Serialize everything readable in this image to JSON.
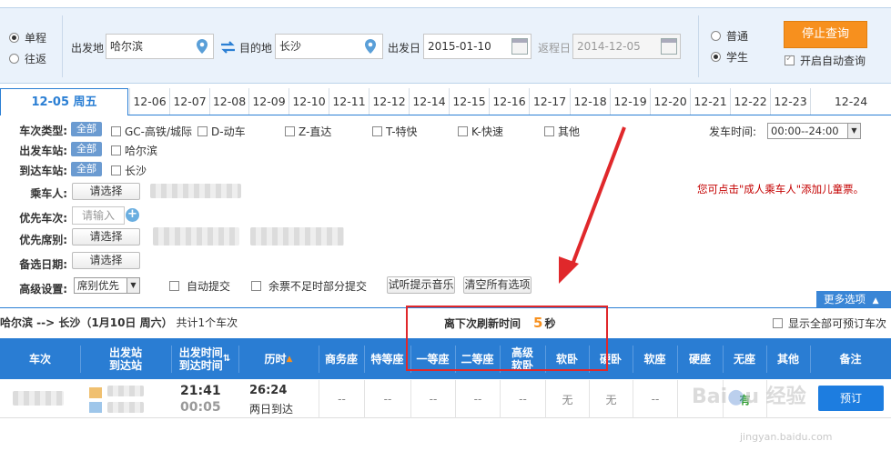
{
  "search": {
    "trip_type": {
      "one_way": "单程",
      "round_trip": "往返",
      "selected": "one_way"
    },
    "from_label": "出发地",
    "from_value": "哈尔滨",
    "to_label": "目的地",
    "to_value": "长沙",
    "depart_label": "出发日",
    "depart_value": "2015-01-10",
    "return_label": "返程日",
    "return_value": "2014-12-05",
    "ticket_type": {
      "normal": "普通",
      "student": "学生",
      "selected": "student"
    },
    "stop_button": "停止查询",
    "auto_query": "开启自动查询"
  },
  "dates": {
    "active": "12-05 周五",
    "tabs": [
      "12-06",
      "12-07",
      "12-08",
      "12-09",
      "12-10",
      "12-11",
      "12-12",
      "12-14",
      "12-15",
      "12-16",
      "12-17",
      "12-18",
      "12-19",
      "12-20",
      "12-21",
      "12-22",
      "12-23",
      "12-24"
    ]
  },
  "filters": {
    "train_type_label": "车次类型:",
    "all": "全部",
    "train_types": [
      "GC-高铁/城际",
      "D-动车",
      "Z-直达",
      "T-特快",
      "K-快速",
      "其他"
    ],
    "from_station_label": "出发车站:",
    "from_station": "哈尔滨",
    "to_station_label": "到达车站:",
    "to_station": "长沙",
    "depart_time_label": "发车时间:",
    "depart_time_value": "00:00--24:00",
    "passenger_label": "乘车人:",
    "choose": "请选择",
    "priority_train_label": "优先车次:",
    "priority_train_placeholder": "请输入",
    "priority_seat_label": "优先席别:",
    "backup_date_label": "备选日期:",
    "advanced_label": "高级设置:",
    "advanced_select": "席别优先",
    "auto_submit": "自动提交",
    "partial_submit": "余票不足时部分提交",
    "test_music": "试听提示音乐",
    "clear_all": "清空所有选项",
    "child_hint": "您可点击\"成人乘车人\"添加儿童票。",
    "more_options": "更多选项"
  },
  "results": {
    "summary_route": "哈尔滨 --> 长沙（1月10日 周六）",
    "summary_count": "共计1个车次",
    "refresh_label": "离下次刷新时间",
    "refresh_count": "5",
    "refresh_unit": "秒",
    "show_all": "显示全部可预订车次",
    "headers": [
      "车次",
      "出发站\n到达站",
      "出发时间\n到达时间",
      "历时",
      "商务座",
      "特等座",
      "一等座",
      "二等座",
      "高级\n软卧",
      "软卧",
      "硬卧",
      "软座",
      "硬座",
      "无座",
      "其他",
      "备注"
    ],
    "row": {
      "depart_time": "21:41",
      "arrive_time": "00:05",
      "duration": "26:24",
      "arrive_day": "两日到达",
      "seats": [
        "--",
        "--",
        "--",
        "--",
        "--",
        "无",
        "无",
        "--",
        "",
        "有",
        ""
      ],
      "book": "预订"
    }
  },
  "watermark": {
    "brand": "Baidu 经验",
    "url": "jingyan.baidu.com"
  }
}
